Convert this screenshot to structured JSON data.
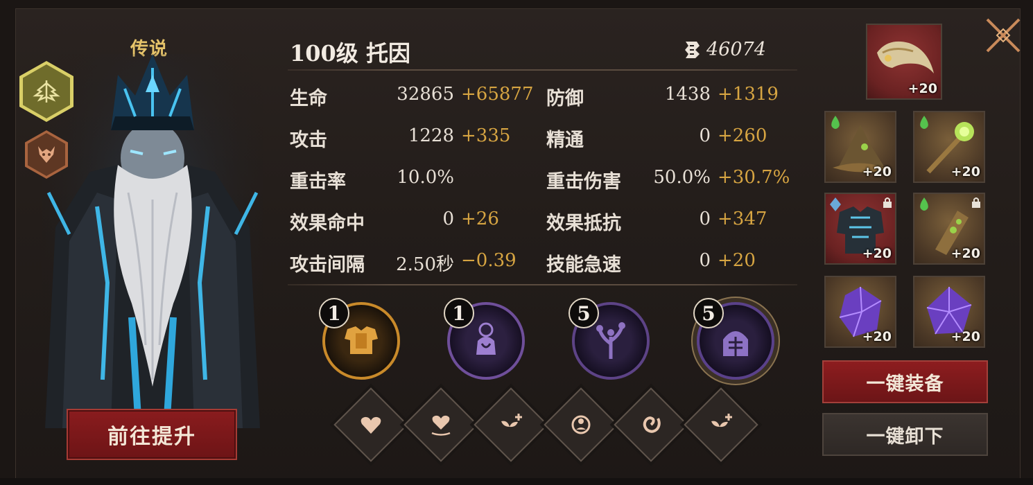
{
  "hero": {
    "rarity": "传说",
    "name": "100级  托因",
    "power": "46074"
  },
  "stats": [
    {
      "name": "生命",
      "base": "32865",
      "bonus": "+65877"
    },
    {
      "name": "防御",
      "base": "1438",
      "bonus": "+1319"
    },
    {
      "name": "攻击",
      "base": "1228",
      "bonus": "+335"
    },
    {
      "name": "精通",
      "base": "0",
      "bonus": "+260"
    },
    {
      "name": "重击率",
      "base": "10.0%",
      "bonus": ""
    },
    {
      "name": "重击伤害",
      "base": "50.0%",
      "bonus": "+30.7%"
    },
    {
      "name": "效果命中",
      "base": "0",
      "bonus": "+26"
    },
    {
      "name": "效果抵抗",
      "base": "0",
      "bonus": "+347"
    },
    {
      "name": "攻击间隔",
      "base": "2.50秒",
      "bonus": "−0.39"
    },
    {
      "name": "技能急速",
      "base": "0",
      "bonus": "+20"
    }
  ],
  "skills": [
    {
      "level": "1",
      "icon": "armor-skill-icon",
      "color": "#c98a2a"
    },
    {
      "level": "1",
      "icon": "gnome-skill-icon",
      "color": "#6f4f9a"
    },
    {
      "level": "5",
      "icon": "tree-skill-icon",
      "color": "#5d4386"
    },
    {
      "level": "5",
      "icon": "helmet-skill-icon",
      "color": "#5a418a"
    }
  ],
  "runes": [
    {
      "icon": "heart-rune-icon"
    },
    {
      "icon": "heart-water-rune-icon"
    },
    {
      "icon": "sprout-plus-rune-icon"
    },
    {
      "icon": "cycle-rune-icon"
    },
    {
      "icon": "swirl-rune-icon"
    },
    {
      "icon": "sprout-plus-rune-icon"
    }
  ],
  "equipment": {
    "artifact": {
      "level": "+20",
      "icon": "horn-artifact-icon"
    },
    "slots": [
      {
        "level": "+20",
        "icon": "witch-hat-icon"
      },
      {
        "level": "+20",
        "icon": "staff-icon"
      },
      {
        "level": "+20",
        "icon": "dark-armor-icon"
      },
      {
        "level": "+20",
        "icon": "bracer-icon"
      },
      {
        "level": "+20",
        "icon": "purple-crystal-icon"
      },
      {
        "level": "+20",
        "icon": "purple-crystal-icon"
      }
    ]
  },
  "buttons": {
    "upgrade": "前往提升",
    "equip_all": "一键装备",
    "unequip_all": "一键卸下"
  },
  "colors": {
    "bonus": "#d7a542",
    "accent_red": "#8a1c1e",
    "rarity_gold": "#e6c46a"
  }
}
